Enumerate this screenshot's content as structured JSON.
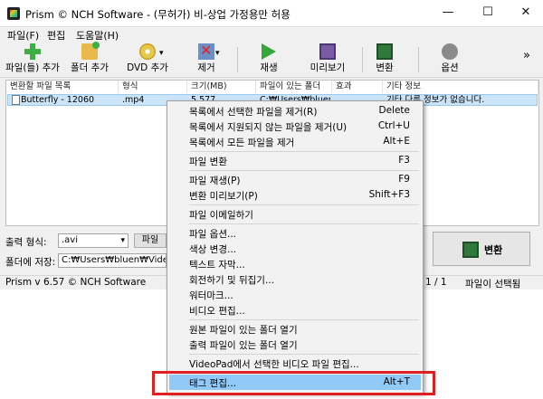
{
  "window": {
    "title": "Prism © NCH Software - (무허가) 비-상업 가정용만 허용",
    "controls": {
      "minimize": "—",
      "maximize": "☐",
      "close": "✕"
    }
  },
  "menu": [
    "파일(F)",
    "편집",
    "도움말(H)"
  ],
  "toolbar": {
    "add_files": "파일(들) 추가",
    "add_folder": "폴더 추가",
    "add_dvd": "DVD 추가",
    "remove": "제거",
    "play": "재생",
    "preview": "미리보기",
    "convert": "변환",
    "options": "옵션",
    "more": "»",
    "dropdown_arrow": "▾"
  },
  "file_list": {
    "columns": [
      "변환할 파일 목록",
      "형식",
      "크기(MB)",
      "파일이 있는 폴더",
      "효과",
      "기타 정보"
    ],
    "rows": [
      {
        "name": "Butterfly - 12060",
        "format": ".mp4",
        "size": "5.577",
        "folder": "C:₩Users₩bluen₩D",
        "effect": "",
        "info": "기타 다른 정보가 없습니다."
      }
    ]
  },
  "output": {
    "format_label": "출력 형식:",
    "format_value": ".avi",
    "arrow": "▾",
    "partial_button": "파일",
    "folder_label": "폴더에 저장:",
    "folder_value": "C:₩Users₩bluen₩Videos",
    "convert_button": "변환"
  },
  "status": {
    "version": "Prism v 6.57 © NCH Software",
    "count": "1  /  1",
    "selected": "파일이 선택됨"
  },
  "context_menu": [
    {
      "label": "목록에서 선택한 파일을 제거(R)",
      "shortcut": "Delete"
    },
    {
      "label": "목록에서 지원되지 않는 파일을 제거(U)",
      "shortcut": "Ctrl+U"
    },
    {
      "label": "목록에서 모든 파일을 제거",
      "shortcut": "Alt+E"
    },
    {
      "label": "파일 변환",
      "shortcut": "F3"
    },
    {
      "label": "파일 재생(P)",
      "shortcut": "F9"
    },
    {
      "label": "변환 미리보기(P)",
      "shortcut": "Shift+F3"
    },
    {
      "label": "파일 이메일하기",
      "shortcut": ""
    },
    {
      "label": "파일 옵션...",
      "shortcut": ""
    },
    {
      "label": "색상 변경...",
      "shortcut": ""
    },
    {
      "label": "텍스트 자막...",
      "shortcut": ""
    },
    {
      "label": "회전하기 및 뒤집기...",
      "shortcut": ""
    },
    {
      "label": "워터마크...",
      "shortcut": ""
    },
    {
      "label": "비디오 편집...",
      "shortcut": ""
    },
    {
      "label": "원본 파일이 있는 폴더 열기",
      "shortcut": ""
    },
    {
      "label": "출력 파일이 있는 폴더 열기",
      "shortcut": ""
    },
    {
      "label": "VideoPad에서 선택한 비디오 파일 편집...",
      "shortcut": ""
    },
    {
      "label": "태그 편집...",
      "shortcut": "Alt+T"
    }
  ],
  "colors": {
    "highlight": "#91c9f7",
    "selection": "#cce4f7",
    "annotation": "#e02020"
  }
}
